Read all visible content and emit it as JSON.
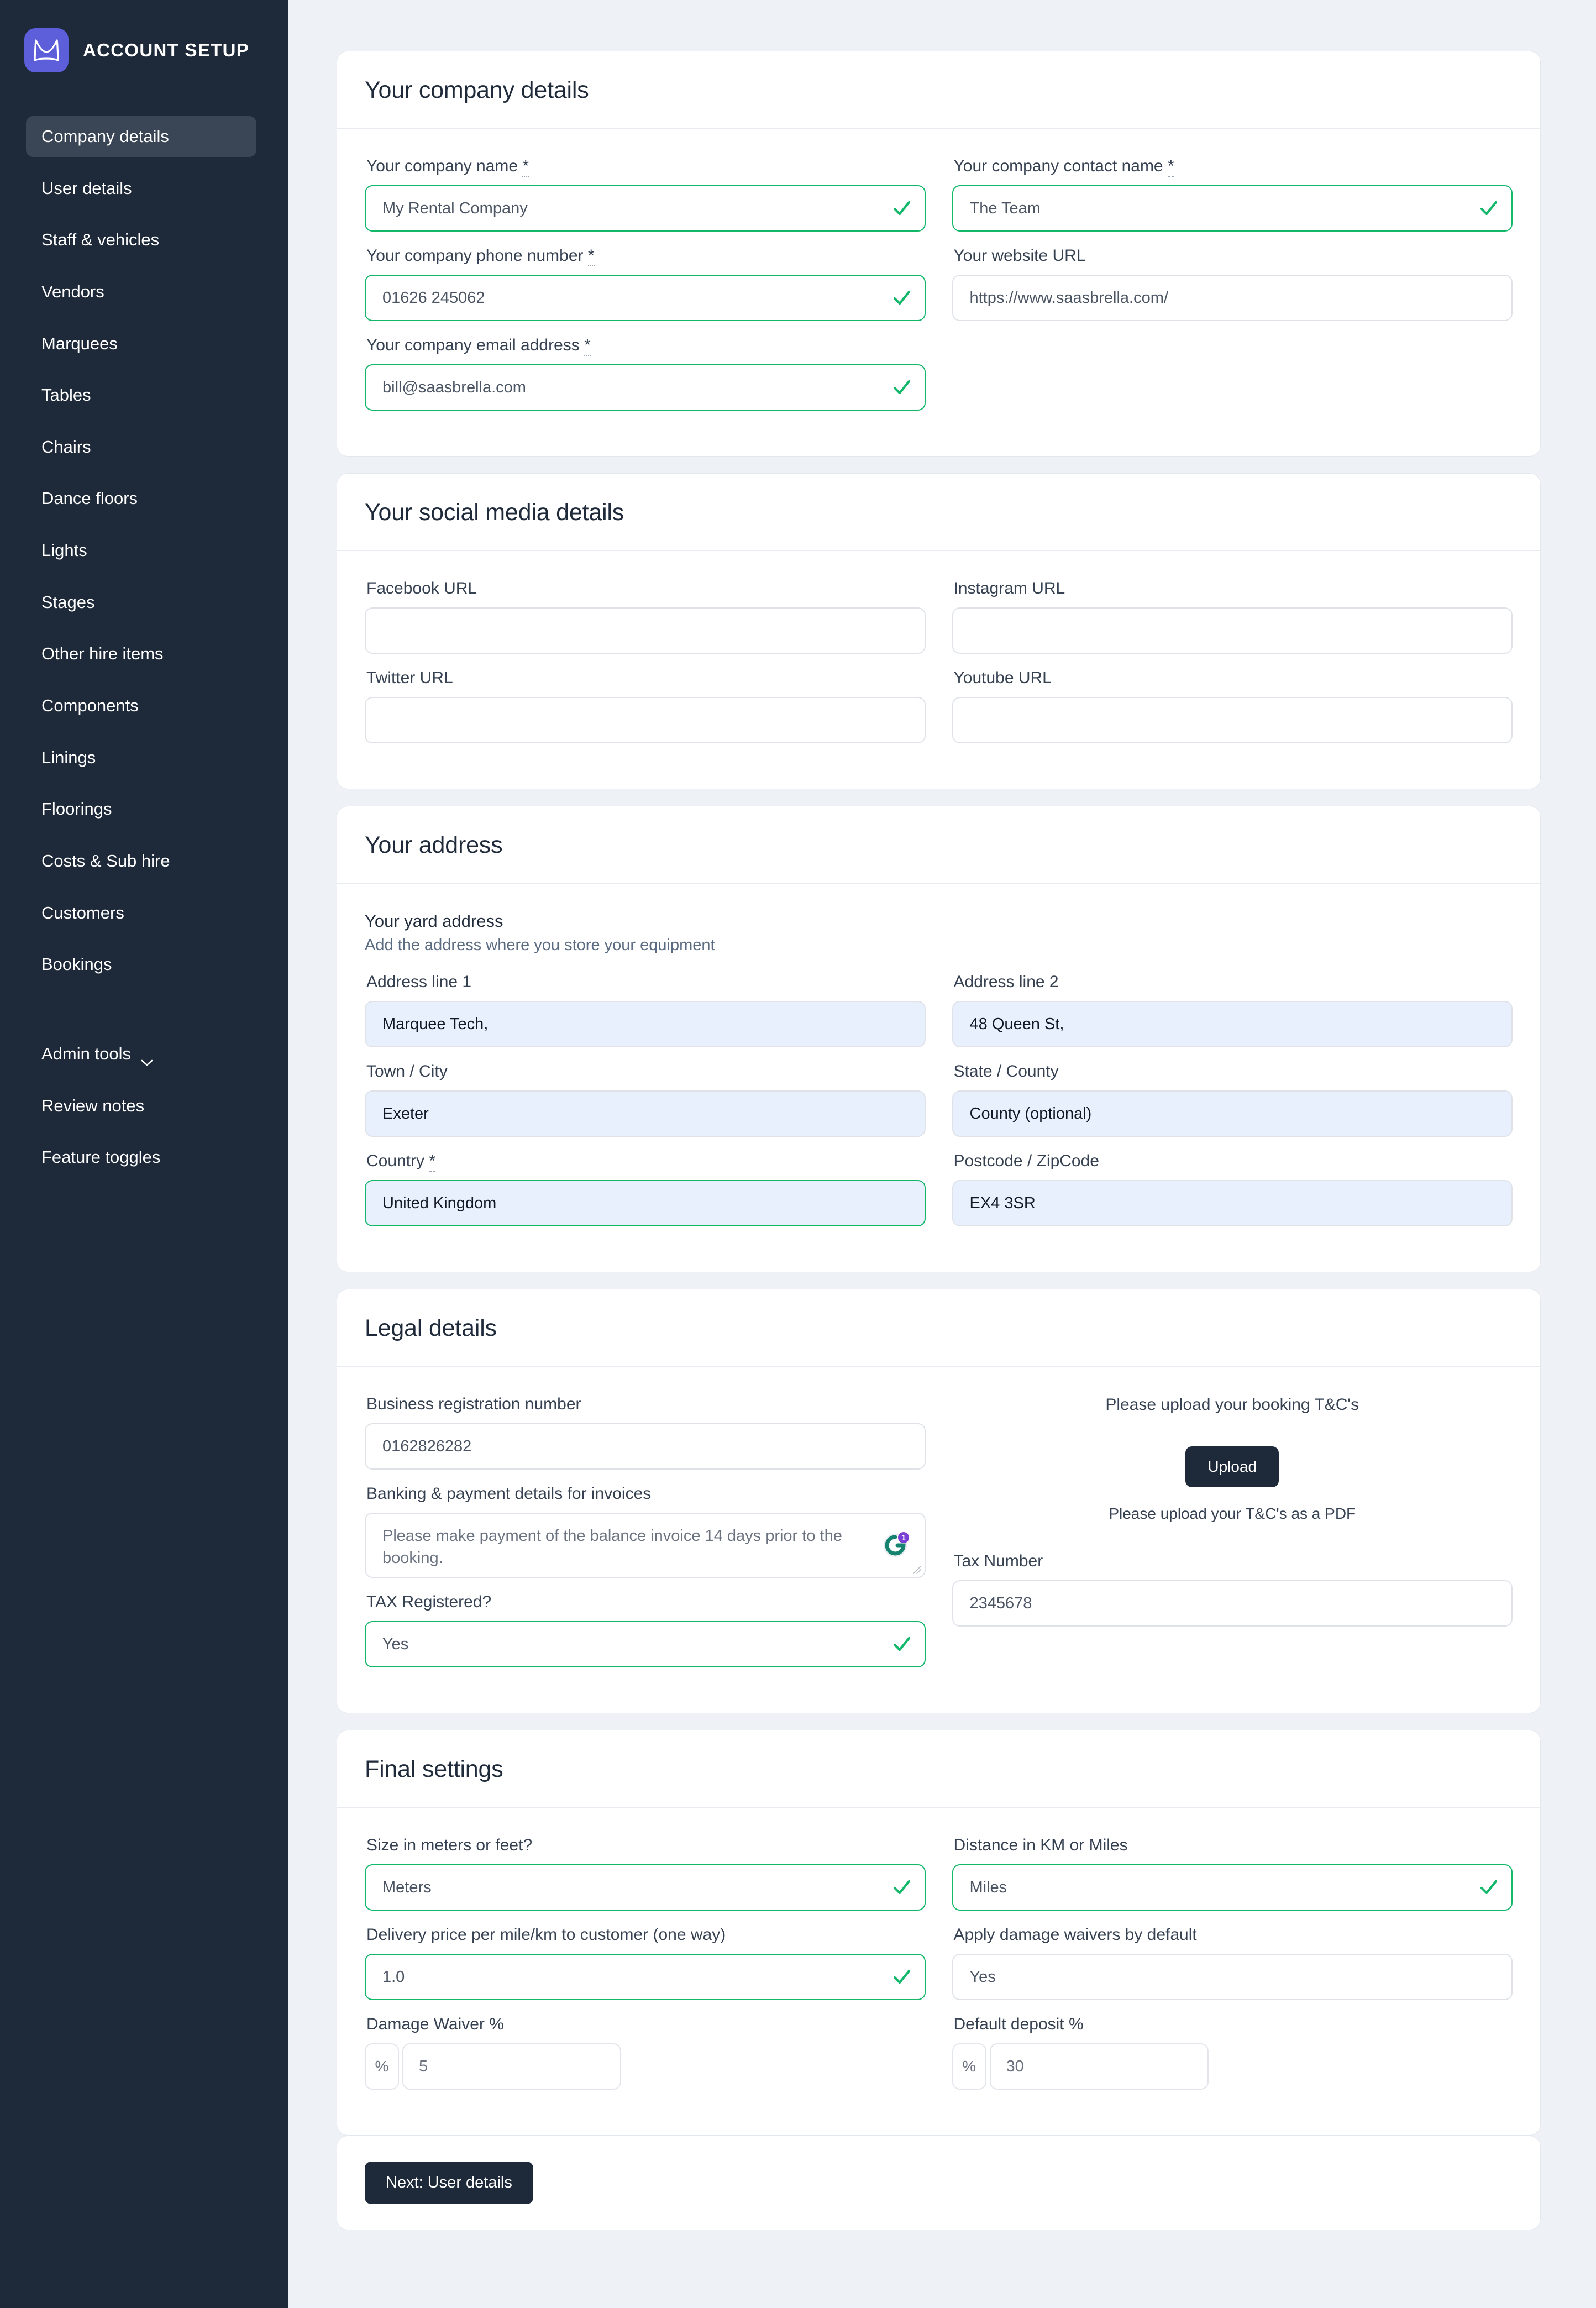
{
  "sidebar": {
    "brand_title": "ACCOUNT SETUP",
    "logo_icon": "marquee-logo-icon",
    "logo_color": "#5d5fda",
    "items": [
      {
        "label": "Company details",
        "active": true
      },
      {
        "label": "User details",
        "active": false
      },
      {
        "label": "Staff & vehicles",
        "active": false
      },
      {
        "label": "Vendors",
        "active": false
      },
      {
        "label": "Marquees",
        "active": false
      },
      {
        "label": "Tables",
        "active": false
      },
      {
        "label": "Chairs",
        "active": false
      },
      {
        "label": "Dance floors",
        "active": false
      },
      {
        "label": "Lights",
        "active": false
      },
      {
        "label": "Stages",
        "active": false
      },
      {
        "label": "Other hire items",
        "active": false
      },
      {
        "label": "Components",
        "active": false
      },
      {
        "label": "Linings",
        "active": false
      },
      {
        "label": "Floorings",
        "active": false
      },
      {
        "label": "Costs & Sub hire",
        "active": false
      },
      {
        "label": "Customers",
        "active": false
      },
      {
        "label": "Bookings",
        "active": false
      }
    ],
    "admin_items": [
      {
        "label": "Admin tools",
        "caret": "chevron-down-icon"
      },
      {
        "label": "Review notes"
      },
      {
        "label": "Feature toggles"
      }
    ]
  },
  "company": {
    "title": "Your company details",
    "name_label": "Your company name",
    "name_value": "My Rental Company",
    "contact_label": "Your company contact name",
    "contact_value": "The Team",
    "phone_label": "Your company phone number",
    "phone_value": "01626 245062",
    "website_label": "Your website URL",
    "website_value": "https://www.saasbrella.com/",
    "email_label": "Your company email address",
    "email_value": "bill@saasbrella.com",
    "required_mark": "*"
  },
  "social": {
    "title": "Your social media details",
    "facebook_label": "Facebook URL",
    "facebook_value": "",
    "instagram_label": "Instagram URL",
    "instagram_value": "",
    "twitter_label": "Twitter URL",
    "twitter_value": "",
    "youtube_label": "Youtube URL",
    "youtube_value": ""
  },
  "address": {
    "title": "Your address",
    "sub_title": "Your yard address",
    "sub_desc": "Add the address where you store your equipment",
    "line1_label": "Address line 1",
    "line1_value": "Marquee Tech,",
    "line2_label": "Address line 2",
    "line2_value": "48 Queen St,",
    "town_label": "Town / City",
    "town_value": "Exeter",
    "state_label": "State / County",
    "state_value": "County (optional)",
    "country_label": "Country",
    "country_value": "United Kingdom",
    "postcode_label": "Postcode / ZipCode",
    "postcode_value": "EX4 3SR",
    "required_mark": "*"
  },
  "legal": {
    "title": "Legal details",
    "reg_label": "Business registration number",
    "reg_value": "0162826282",
    "banking_label": "Banking & payment details for invoices",
    "banking_value": "Please make payment of the balance invoice 14 days prior to the booking.",
    "grammarly_icon": "grammarly-icon",
    "grammarly_badge": "1",
    "tax_reg_label": "TAX Registered?",
    "tax_reg_value": "Yes",
    "tax_num_label": "Tax Number",
    "tax_num_value": "2345678",
    "upload_heading": "Please upload your booking T&C's",
    "upload_button": "Upload",
    "upload_note": "Please upload your T&C's as a PDF"
  },
  "final": {
    "title": "Final settings",
    "size_label": "Size in meters or feet?",
    "size_value": "Meters",
    "distance_label": "Distance in KM or Miles",
    "distance_value": "Miles",
    "delivery_label": "Delivery price per mile/km to customer (one way)",
    "delivery_value": "1.0",
    "waiver_default_label": "Apply damage waivers by default",
    "waiver_default_value": "Yes",
    "damage_waiver_label": "Damage Waiver %",
    "damage_waiver_addon": "%",
    "damage_waiver_value": "5",
    "deposit_label": "Default deposit %",
    "deposit_addon": "%",
    "deposit_value": "30"
  },
  "footer": {
    "next_button": "Next: User details"
  },
  "colors": {
    "sidebar_bg": "#1e2939",
    "accent": "#5d5fda",
    "valid_border": "#12b76a",
    "autofill_bg": "#e8f0fe",
    "page_bg": "#eef2f6",
    "dark_button": "#1e2939"
  }
}
